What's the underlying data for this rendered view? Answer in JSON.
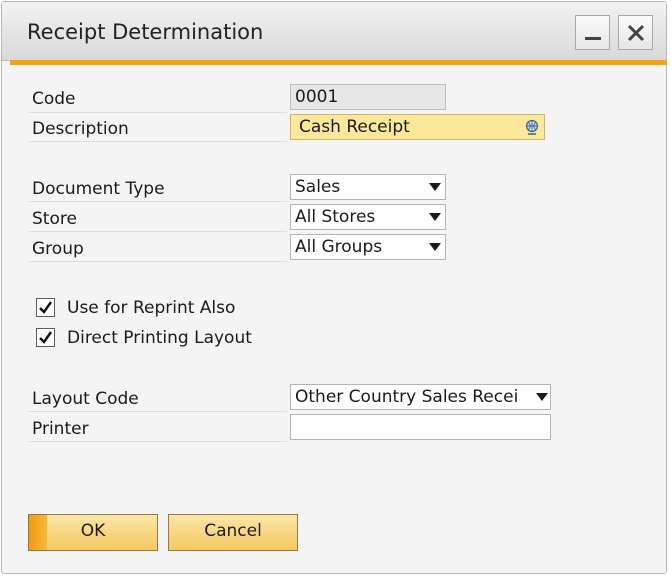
{
  "window": {
    "title": "Receipt Determination",
    "minimize_icon": "minimize-icon",
    "close_icon": "close-icon",
    "accent_color": "#f3a10e"
  },
  "form": {
    "code_label": "Code",
    "code_value": "0001",
    "description_label": "Description",
    "description_value": "Cash Receipt",
    "description_icon": "globe-icon",
    "document_type_label": "Document Type",
    "document_type_value": "Sales",
    "store_label": "Store",
    "store_value": "All Stores",
    "group_label": "Group",
    "group_value": "All Groups",
    "reprint_label": "Use for Reprint Also",
    "reprint_checked": true,
    "direct_printing_label": "Direct Printing Layout",
    "direct_printing_checked": true,
    "layout_code_label": "Layout Code",
    "layout_code_value": "Other Country Sales Recei",
    "printer_label": "Printer",
    "printer_value": ""
  },
  "buttons": {
    "ok_label": "OK",
    "cancel_label": "Cancel"
  }
}
